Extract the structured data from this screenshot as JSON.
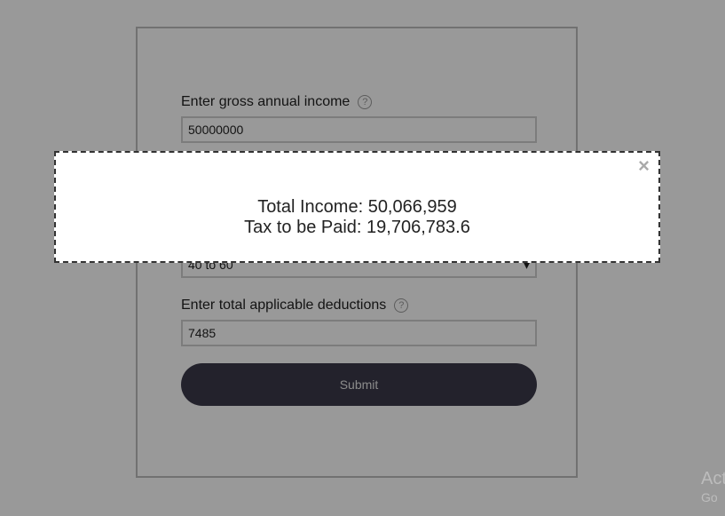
{
  "form": {
    "gross_income_label": "Enter gross annual income",
    "gross_income_value": "50000000",
    "age_select_value": "40 to 60",
    "deductions_label": "Enter total applicable deductions",
    "deductions_value": "7485",
    "submit_label": "Submit",
    "help_glyph": "?"
  },
  "modal": {
    "close_glyph": "×",
    "total_income": "Total Income: 50,066,959",
    "tax_to_be_paid": "Tax to be Paid: 19,706,783.6"
  },
  "watermark": {
    "line1": "Act",
    "line2": "Go"
  },
  "colors": {
    "overlay": "#000000",
    "button": "#3b3a4a",
    "modal_border": "#333333"
  }
}
